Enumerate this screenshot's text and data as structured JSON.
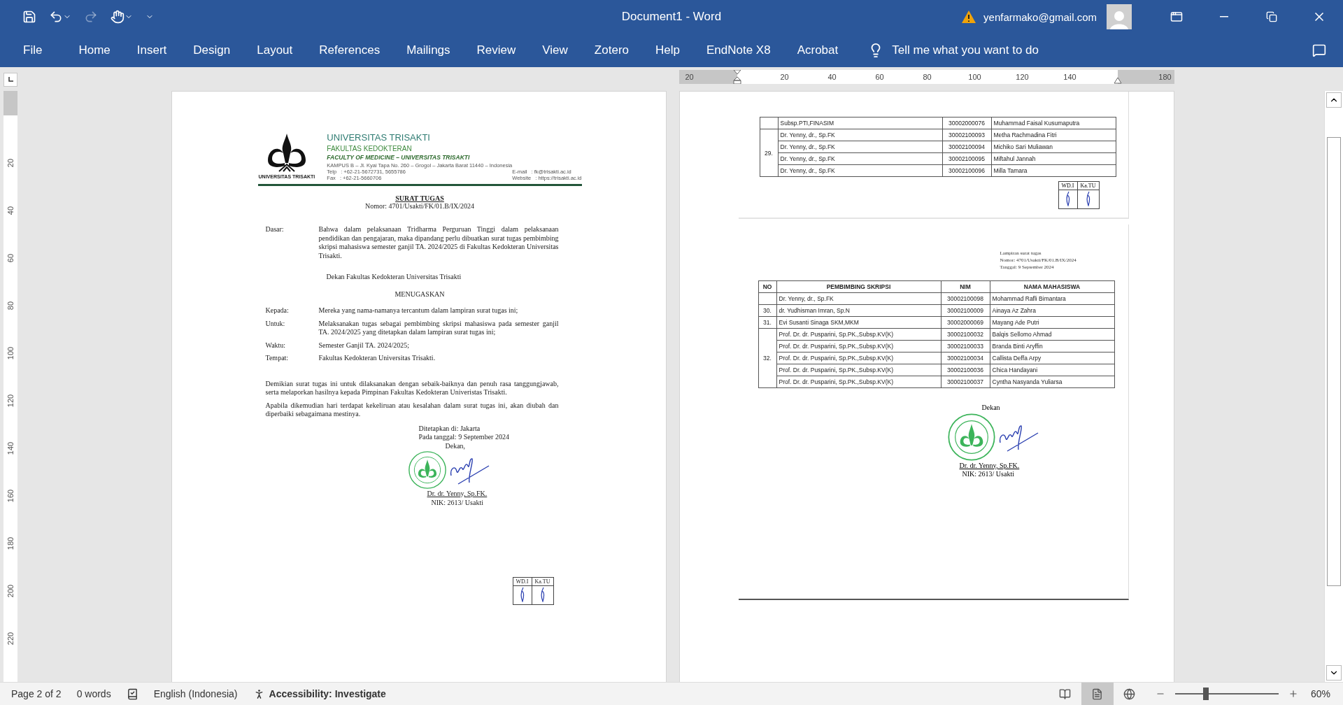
{
  "title_bar": {
    "redo": {
      "disabled": true
    },
    "document_title": "Document1  -  Word",
    "account": "yenfarmako@gmail.com"
  },
  "ribbon": {
    "tabs": [
      {
        "label": "File"
      },
      {
        "label": "Home"
      },
      {
        "label": "Insert"
      },
      {
        "label": "Design"
      },
      {
        "label": "Layout"
      },
      {
        "label": "References"
      },
      {
        "label": "Mailings"
      },
      {
        "label": "Review"
      },
      {
        "label": "View"
      },
      {
        "label": "Zotero"
      },
      {
        "label": "Help"
      },
      {
        "label": "EndNote X8"
      },
      {
        "label": "Acrobat"
      }
    ],
    "tell_me": {
      "placeholder": "Tell me what you want to do"
    }
  },
  "horizontal_ruler": {
    "ticks": [
      {
        "kind": "number",
        "label": "20"
      },
      {
        "kind": "left-indent"
      },
      {
        "kind": "number",
        "label": "20"
      },
      {
        "kind": "number",
        "label": "40"
      },
      {
        "kind": "number",
        "label": "60"
      },
      {
        "kind": "number",
        "label": "80"
      },
      {
        "kind": "number",
        "label": "100"
      },
      {
        "kind": "number",
        "label": "120"
      },
      {
        "kind": "number",
        "label": "140"
      },
      {
        "kind": "right-indent"
      },
      {
        "kind": "number",
        "label": "180"
      }
    ]
  },
  "vertical_ruler": {
    "labels": [
      "20",
      "40",
      "60",
      "80",
      "100",
      "120",
      "140",
      "160",
      "180",
      "200",
      "220"
    ]
  },
  "pages": [
    {
      "kind": "letter",
      "letterhead": {
        "logo_caption": "UNIVERSITAS TRISAKTI",
        "university": "UNIVERSITAS TRISAKTI",
        "faculty": "FAKULTAS KEDOKTERAN",
        "faculty_en": "FACULTY OF MEDICINE – UNIVERSITAS TRISAKTI",
        "address": "KAMPUS B – Jl. Kyai Tapa No. 260 – Grogol – Jakarta Barat 11440 – Indonesia",
        "contacts": [
          {
            "label": "Telp",
            "value": ": +62-21-5672731, 5655786"
          },
          {
            "label": "Fax",
            "value": ": +62-21-5660706"
          }
        ],
        "online": [
          {
            "label": "E-mail",
            "value": ": fk@trisakti.ac.id"
          },
          {
            "label": "Website",
            "value": ": https://trisakti.ac.id"
          }
        ]
      },
      "title": "SURAT TUGAS",
      "number": "Nomor: 4701/Usakti/FK/01.B/IX/2024",
      "basis": {
        "label": "Dasar:",
        "text": "Bahwa dalam pelaksanaan Tridharma Perguruan Tinggi dalam pelaksanaan pendidikan dan pengajaran, maka dipandang perlu dibuatkan surat tugas pembimbing skripsi mahasiswa semester ganjil TA. 2024/2025 di Fakultas Kedokteran Universitas Trisakti."
      },
      "issuer": "Dekan Fakultas Kedokteran Universitas Trisakti",
      "decision": "MENUGASKAN",
      "assignment": [
        {
          "label": "Kepada:",
          "text": "Mereka yang nama-namanya tercantum dalam lampiran surat tugas ini;"
        },
        {
          "label": "Untuk:",
          "text": "Melaksanakan tugas sebagai pembimbing skripsi mahasiswa pada semester ganjil TA. 2024/2025 yang ditetapkan dalam lampiran surat tugas ini;"
        },
        {
          "label": "Waktu:",
          "text": "Semester Ganjil TA. 2024/2025;"
        },
        {
          "label": "Tempat:",
          "text": "Fakultas Kedokteran Universitas Trisakti."
        }
      ],
      "closing": [
        "Demikian surat tugas ini untuk dilaksanakan dengan sebaik-baiknya dan penuh rasa tanggungjawab, serta melaporkan hasilnya kepada Pimpinan Fakultas Kedokteran Univeristas Trisakti.",
        "Apabila dikemudian hari terdapat kekeliruan atau kesalahan dalam surat tugas ini, akan diubah dan diperbaiki sebagaimana mestinya."
      ],
      "signature": {
        "place": "Ditetapkan di: Jakarta",
        "date": "Pada tanggal: 9 September 2024",
        "role": "Dekan,",
        "name": "Dr. dr. Yenny, Sp.FK.",
        "id": "NIK: 2613/ Usakti"
      },
      "initials": [
        "WD.I",
        "Ka.TU"
      ]
    },
    {
      "kind": "attachment",
      "continued": {
        "groups": [
          {
            "rows": [
              {
                "supervisor": "Subsp.PTI,FINASIM",
                "nim": "30002000076",
                "student": "Muhammad Faisal Kusumaputra"
              }
            ]
          },
          {
            "no": "29.",
            "rows": [
              {
                "supervisor": "Dr. Yenny, dr., Sp.FK",
                "nim": "30002100093",
                "student": "Metha Rachmadina Fitri"
              },
              {
                "supervisor": "Dr. Yenny, dr., Sp.FK",
                "nim": "30002100094",
                "student": "Michiko Sari Muliawan"
              },
              {
                "supervisor": "Dr. Yenny, dr., Sp.FK",
                "nim": "30002100095",
                "student": "Miftahul Jannah"
              },
              {
                "supervisor": "Dr. Yenny, dr., Sp.FK",
                "nim": "30002100096",
                "student": "Milla Tamara"
              }
            ]
          }
        ],
        "initials": [
          "WD.I",
          "Ka.TU"
        ]
      },
      "attachment": {
        "header": [
          "Lampiran surat tugas",
          "Nomor: 4701/Usakti/FK/01.B/IX/2024",
          "Tanggal: 9 September 2024"
        ],
        "columns": [
          "NO",
          "PEMBIMBING SKRIPSI",
          "NIM",
          "NAMA MAHASISWA"
        ],
        "groups": [
          {
            "rows": [
              {
                "supervisor": "Dr. Yenny, dr., Sp.FK",
                "nim": "30002100098",
                "student": "Mohammad Rafli Bimantara"
              }
            ]
          },
          {
            "no": "30.",
            "rows": [
              {
                "supervisor": "dr. Yudhisman Imran, Sp.N",
                "nim": "30002100009",
                "student": "Ainaya Az Zahra"
              }
            ]
          },
          {
            "no": "31.",
            "rows": [
              {
                "supervisor": "Evi Susanti Sinaga SKM,MKM",
                "nim": "30002000069",
                "student": "Mayang Ade Putri"
              }
            ]
          },
          {
            "no": "32.",
            "rows": [
              {
                "supervisor": "Prof. Dr. dr. Pusparini, Sp.PK.,Subsp.KV(K)",
                "nim": "30002100032",
                "student": "Balqis Sellomo Ahmad"
              },
              {
                "supervisor": "Prof. Dr. dr. Pusparini, Sp.PK.,Subsp.KV(K)",
                "nim": "30002100033",
                "student": "Branda Binti Aryffin"
              },
              {
                "supervisor": "Prof. Dr. dr. Pusparini, Sp.PK.,Subsp.KV(K)",
                "nim": "30002100034",
                "student": "Callista Deffa Arpy"
              },
              {
                "supervisor": "Prof. Dr. dr. Pusparini, Sp.PK.,Subsp.KV(K)",
                "nim": "30002100036",
                "student": "Chica Handayani"
              },
              {
                "supervisor": "Prof. Dr. dr. Pusparini, Sp.PK.,Subsp.KV(K)",
                "nim": "30002100037",
                "student": "Cyntha Nasyanda Yuliarsa"
              }
            ]
          }
        ],
        "signature": {
          "role": "Dekan",
          "name": "Dr. dr. Yenny, Sp.FK.",
          "id": "NIK: 2613/ Usakti"
        }
      }
    }
  ],
  "status_bar": {
    "page": "Page 2 of 2",
    "words": "0 words",
    "language": "English (Indonesia)",
    "accessibility": "Accessibility: Investigate",
    "views": [
      {
        "kind": "read",
        "selected": false
      },
      {
        "kind": "print",
        "selected": true
      },
      {
        "kind": "web",
        "selected": false
      }
    ],
    "zoom": {
      "level": 0.3,
      "label": "60%"
    }
  }
}
